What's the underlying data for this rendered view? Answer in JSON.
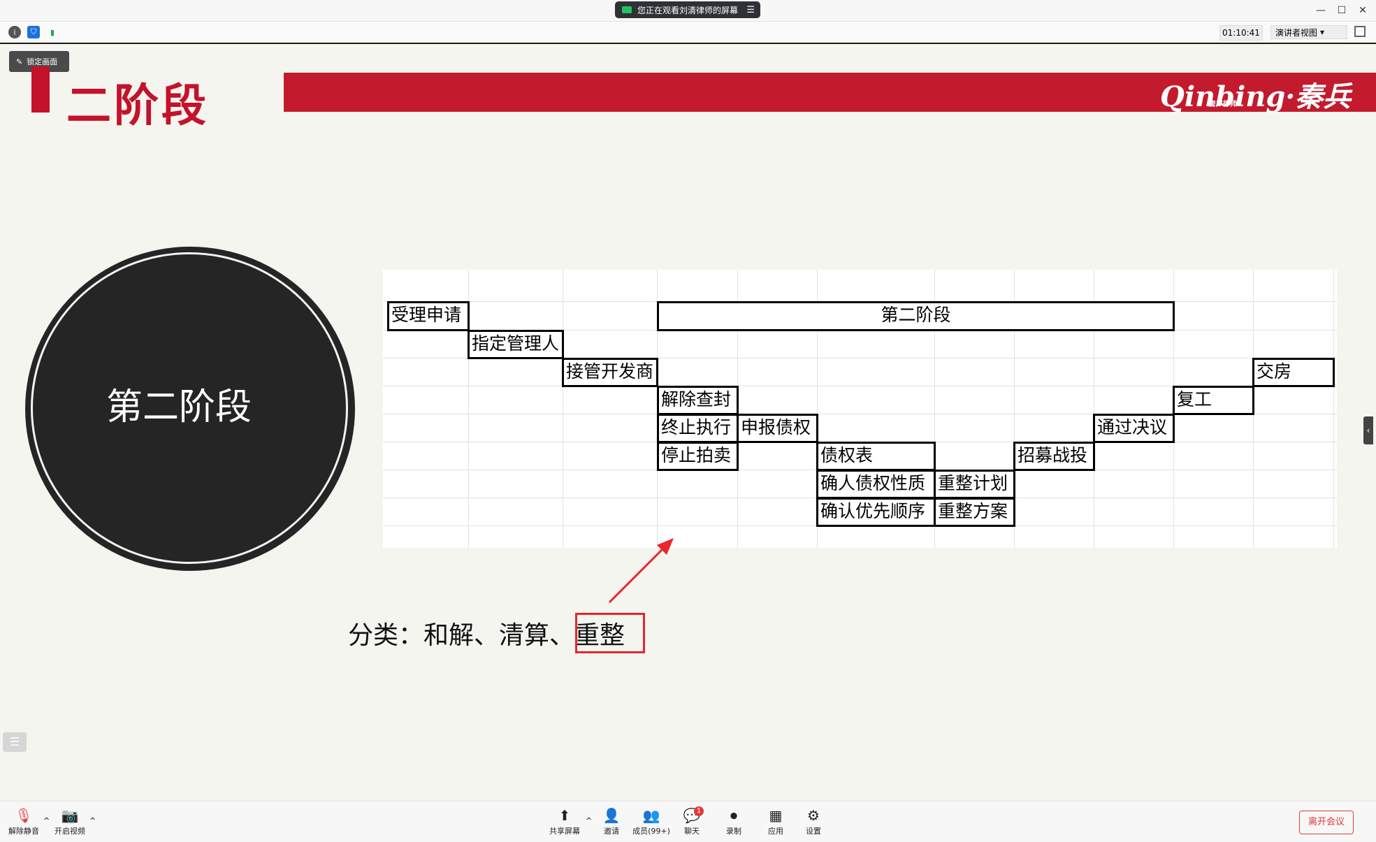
{
  "titlebar": {
    "share_banner": "您正在观看刘清律师的屏幕",
    "menu_glyph": "☰",
    "minimize": "—",
    "maximize": "☐",
    "close": "✕"
  },
  "toolbar": {
    "info_icon": "i",
    "security_icon": "⛉",
    "signal_icon": "▮",
    "timer": "01:10:41",
    "view_mode": "演讲者视图",
    "view_chevron": "▾"
  },
  "lock_button": {
    "label": "锁定画面",
    "pin_glyph": "✎"
  },
  "slide": {
    "title": "二阶段",
    "logo": "Qinbing·秦兵",
    "logo_sub": "房产律师",
    "circle_text": "第二阶段",
    "caption_prefix": "分类：和解、清算、",
    "caption_highlight": "重整",
    "table": {
      "stage": "第二阶段",
      "accept": "受理申请",
      "appoint": "指定管理人",
      "takeover": "接管开发商",
      "release": "解除查封",
      "terminate": "终止执行",
      "declare": "申报债权",
      "stop_auction": "停止拍卖",
      "claims": "债权表",
      "nature": "确人债权性质",
      "priority": "确认优先顺序",
      "plan": "重整计划",
      "scheme": "重整方案",
      "recruit": "招募战投",
      "vote": "通过决议",
      "resume": "复工",
      "deliver": "交房"
    }
  },
  "bottombar": {
    "unmute": "解除静音",
    "video": "开启视频",
    "share": "共享屏幕",
    "invite": "邀请",
    "members": "成员(99+)",
    "chat": "聊天",
    "chat_badge": "1",
    "record": "录制",
    "apps": "应用",
    "settings": "设置",
    "leave": "离开会议"
  },
  "colors": {
    "brand_red": "#c31a2d",
    "highlight_red": "#e8262c"
  }
}
